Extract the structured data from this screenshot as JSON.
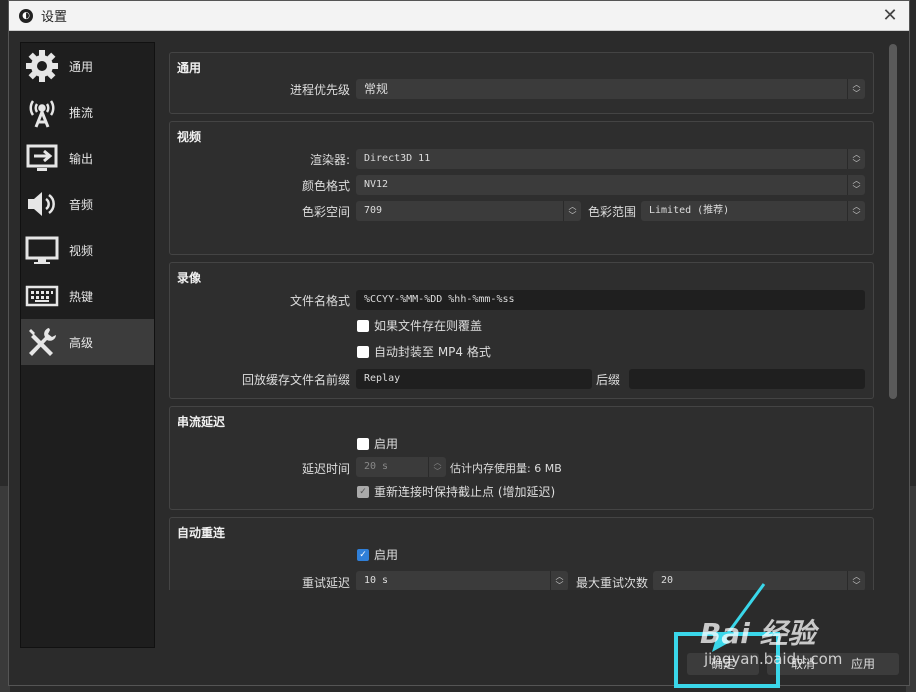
{
  "dialog": {
    "title": "设置",
    "close": "✕"
  },
  "sidebar": {
    "items": [
      {
        "label": "通用",
        "icon": "gear-icon",
        "active": false
      },
      {
        "label": "推流",
        "icon": "broadcast-icon",
        "active": false
      },
      {
        "label": "输出",
        "icon": "output-icon",
        "active": false
      },
      {
        "label": "音频",
        "icon": "speaker-icon",
        "active": false
      },
      {
        "label": "视频",
        "icon": "monitor-icon",
        "active": false
      },
      {
        "label": "热键",
        "icon": "keyboard-icon",
        "active": false
      },
      {
        "label": "高级",
        "icon": "wrench-screwdriver-icon",
        "active": true
      }
    ]
  },
  "general": {
    "title": "通用",
    "priority_label": "进程优先级",
    "priority_value": "常规"
  },
  "video": {
    "title": "视频",
    "renderer_label": "渲染器:",
    "renderer_value": "Direct3D 11",
    "color_format_label": "颜色格式",
    "color_format_value": "NV12",
    "color_space_label": "色彩空间",
    "color_space_value": "709",
    "color_range_label": "色彩范围",
    "color_range_value": "Limited (推荐)"
  },
  "recording": {
    "title": "录像",
    "filename_format_label": "文件名格式",
    "filename_format_value": "%CCYY-%MM-%DD %hh-%mm-%ss",
    "overwrite_label": "如果文件存在则覆盖",
    "overwrite_checked": false,
    "remux_label": "自动封装至 MP4 格式",
    "remux_checked": false,
    "replay_prefix_label": "回放缓存文件名前缀",
    "replay_prefix_value": "Replay",
    "suffix_label": "后缀",
    "suffix_value": ""
  },
  "stream_delay": {
    "title": "串流延迟",
    "enable_label": "启用",
    "enable_checked": false,
    "delay_label": "延迟时间",
    "delay_value": "20 s",
    "memory_estimate": "估计内存使用量: 6 MB",
    "preserve_label": "重新连接时保持截止点 (增加延迟)",
    "preserve_checked": true
  },
  "auto_reconnect": {
    "title": "自动重连",
    "enable_label": "启用",
    "enable_checked": true,
    "retry_delay_label": "重试延迟",
    "retry_delay_value": "10 s",
    "max_retries_label": "最大重试次数",
    "max_retries_value": "20"
  },
  "buttons": {
    "ok": "确定",
    "cancel": "取消",
    "apply": "应用"
  },
  "watermark": {
    "logo": "Bai 经验",
    "url": "jingyan.baidu.com"
  },
  "colors": {
    "highlight": "#3ad7ea",
    "checkbox_checked": "#2f7fd8"
  }
}
